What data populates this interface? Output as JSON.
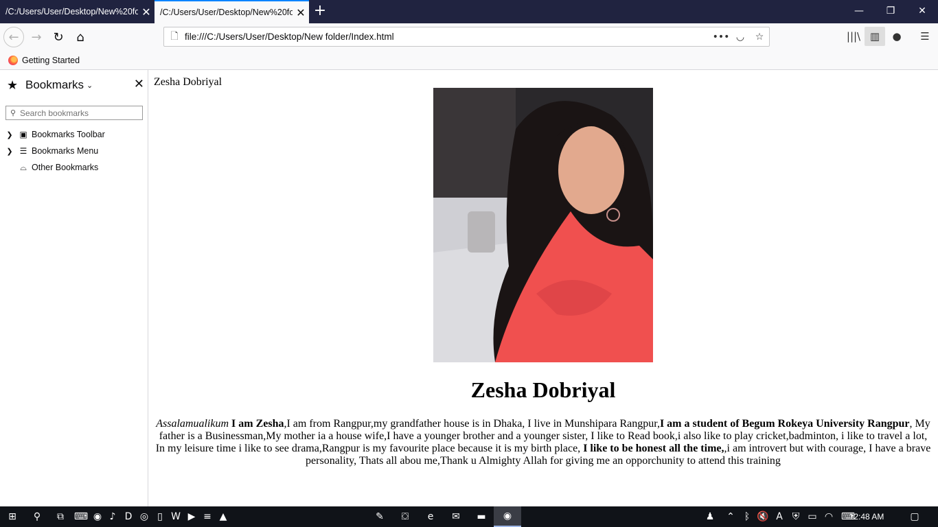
{
  "browser": {
    "tabs": [
      {
        "title": "/C:/Users/User/Desktop/New%20folder/Index.html"
      },
      {
        "title": "/C:/Users/User/Desktop/New%20folder/Index.html"
      }
    ],
    "url": "file:///C:/Users/User/Desktop/New folder/Index.html",
    "bookmarks_toolbar": [
      {
        "label": "Getting Started"
      }
    ]
  },
  "sidebar": {
    "title": "Bookmarks",
    "search_placeholder": "Search bookmarks",
    "items": [
      {
        "label": "Bookmarks Toolbar"
      },
      {
        "label": "Bookmarks Menu"
      },
      {
        "label": "Other Bookmarks"
      }
    ]
  },
  "page": {
    "title_text": "Zesha Dobriyal",
    "heading": "Zesha Dobriyal",
    "paragraph": {
      "greeting": "Assalamualikum",
      "intro_bold": "I am Zesha",
      "part1": ",I am from Rangpur,my grandfather house is in Dhaka, I live in Munshipara Rangpur,",
      "student_bold": "I am a student of Begum Rokeya University Rangpur",
      "part2": ", My father is a Businessman,My mother ia a house wife,I have a younger brother and a younger sister, I like to Read book,i also like to play cricket,badminton, i like to travel a lot, In my leisure time i like to see drama,Rangpur is my favourite place because it is my birth place, ",
      "honest_bold": "I like to be honest all the time,",
      "part3": ",i am introvert but with courage, I have a brave personality, Thats all abou me,Thank u Almighty Allah for giving me an opporchunity to attend this training"
    }
  },
  "taskbar": {
    "clock": "12:48 AM"
  },
  "colors": {
    "tabstrip": "#202340",
    "active_tab_accent": "#0a84ff",
    "taskbar": "#101318"
  }
}
